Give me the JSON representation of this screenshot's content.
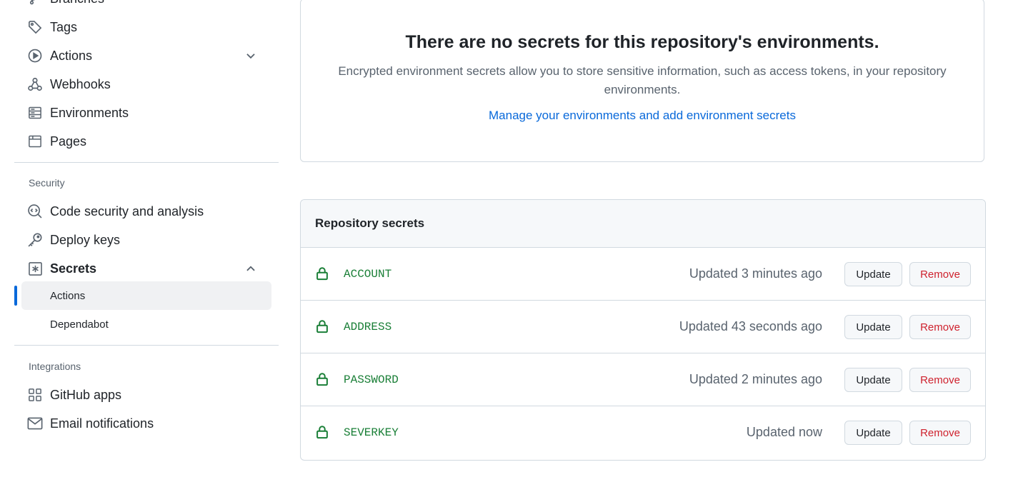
{
  "sidebar": {
    "top_items": [
      {
        "label": "Branches"
      },
      {
        "label": "Tags"
      },
      {
        "label": "Actions"
      },
      {
        "label": "Webhooks"
      },
      {
        "label": "Environments"
      },
      {
        "label": "Pages"
      }
    ],
    "security_label": "Security",
    "security_items": [
      {
        "label": "Code security and analysis"
      },
      {
        "label": "Deploy keys"
      },
      {
        "label": "Secrets"
      }
    ],
    "secrets_subitems": [
      {
        "label": "Actions",
        "active": true
      },
      {
        "label": "Dependabot",
        "active": false
      }
    ],
    "integrations_label": "Integrations",
    "integrations_items": [
      {
        "label": "GitHub apps"
      },
      {
        "label": "Email notifications"
      }
    ]
  },
  "environments": {
    "title": "There are no secrets for this repository's environments.",
    "description": "Encrypted environment secrets allow you to store sensitive information, such as access tokens, in your repository environments.",
    "link": "Manage your environments and add environment secrets"
  },
  "repository_secrets": {
    "heading": "Repository secrets",
    "update_label": "Update",
    "remove_label": "Remove",
    "rows": [
      {
        "name": "ACCOUNT",
        "updated": "Updated 3 minutes ago"
      },
      {
        "name": "ADDRESS",
        "updated": "Updated 43 seconds ago"
      },
      {
        "name": "PASSWORD",
        "updated": "Updated 2 minutes ago"
      },
      {
        "name": "SEVERKEY",
        "updated": "Updated now"
      }
    ]
  },
  "colors": {
    "accent": "#0969da",
    "secret_name": "#1a7f37",
    "danger": "#cf222e"
  }
}
